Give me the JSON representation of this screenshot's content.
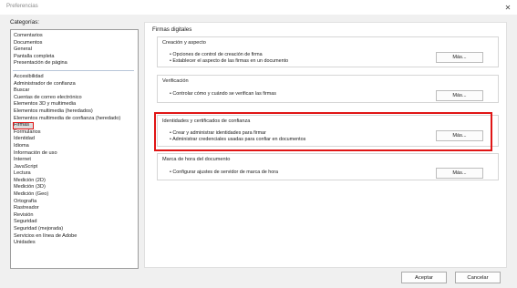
{
  "window": {
    "title": "Preferencias",
    "close_glyph": "✕"
  },
  "categories": {
    "label": "Categorías:",
    "top_items": [
      "Comentarios",
      "Documentos",
      "General",
      "Pantalla completa",
      "Presentación de página"
    ],
    "items": [
      "Accesibilidad",
      "Administrador de confianza",
      "Buscar",
      "Cuentas de correo electrónico",
      "Elementos 3D y multimedia",
      "Elementos multimedia (heredados)",
      "Elementos multimedia de confianza (heredado)",
      "Firmas",
      "Formularios",
      "Identidad",
      "Idioma",
      "Información de uso",
      "Internet",
      "JavaScript",
      "Lectura",
      "Medición (2D)",
      "Medición (3D)",
      "Medición (Geo)",
      "Ortografía",
      "Rastreador",
      "Revisión",
      "Seguridad",
      "Seguridad (mejorada)",
      "Servicios en línea de Adobe",
      "Unidades"
    ],
    "selected": "Firmas"
  },
  "panel": {
    "title": "Firmas digitales",
    "groups": [
      {
        "title": "Creación y aspecto",
        "lines": [
          "• Opciones de control de creación de firma",
          "• Establecer el aspecto de las firmas en un documento"
        ],
        "button": "Más..."
      },
      {
        "title": "Verificación",
        "lines": [
          "• Controlar cómo y cuándo se verifican las firmas"
        ],
        "button": "Más..."
      },
      {
        "title": "Identidades y certificados de confianza",
        "lines": [
          "• Crear y administrar identidades para firmar",
          "• Administrar credenciales usadas para confiar en documentos"
        ],
        "button": "Más..."
      },
      {
        "title": "Marca de hora del documento",
        "lines": [
          "• Configurar ajustes de servidor de marca de hora"
        ],
        "button": "Más..."
      }
    ]
  },
  "footer": {
    "accept": "Aceptar",
    "cancel": "Cancelar"
  },
  "colors": {
    "highlight": "#e01515",
    "window_bg": "#f0f0f0",
    "panel_bg": "#ffffff"
  }
}
